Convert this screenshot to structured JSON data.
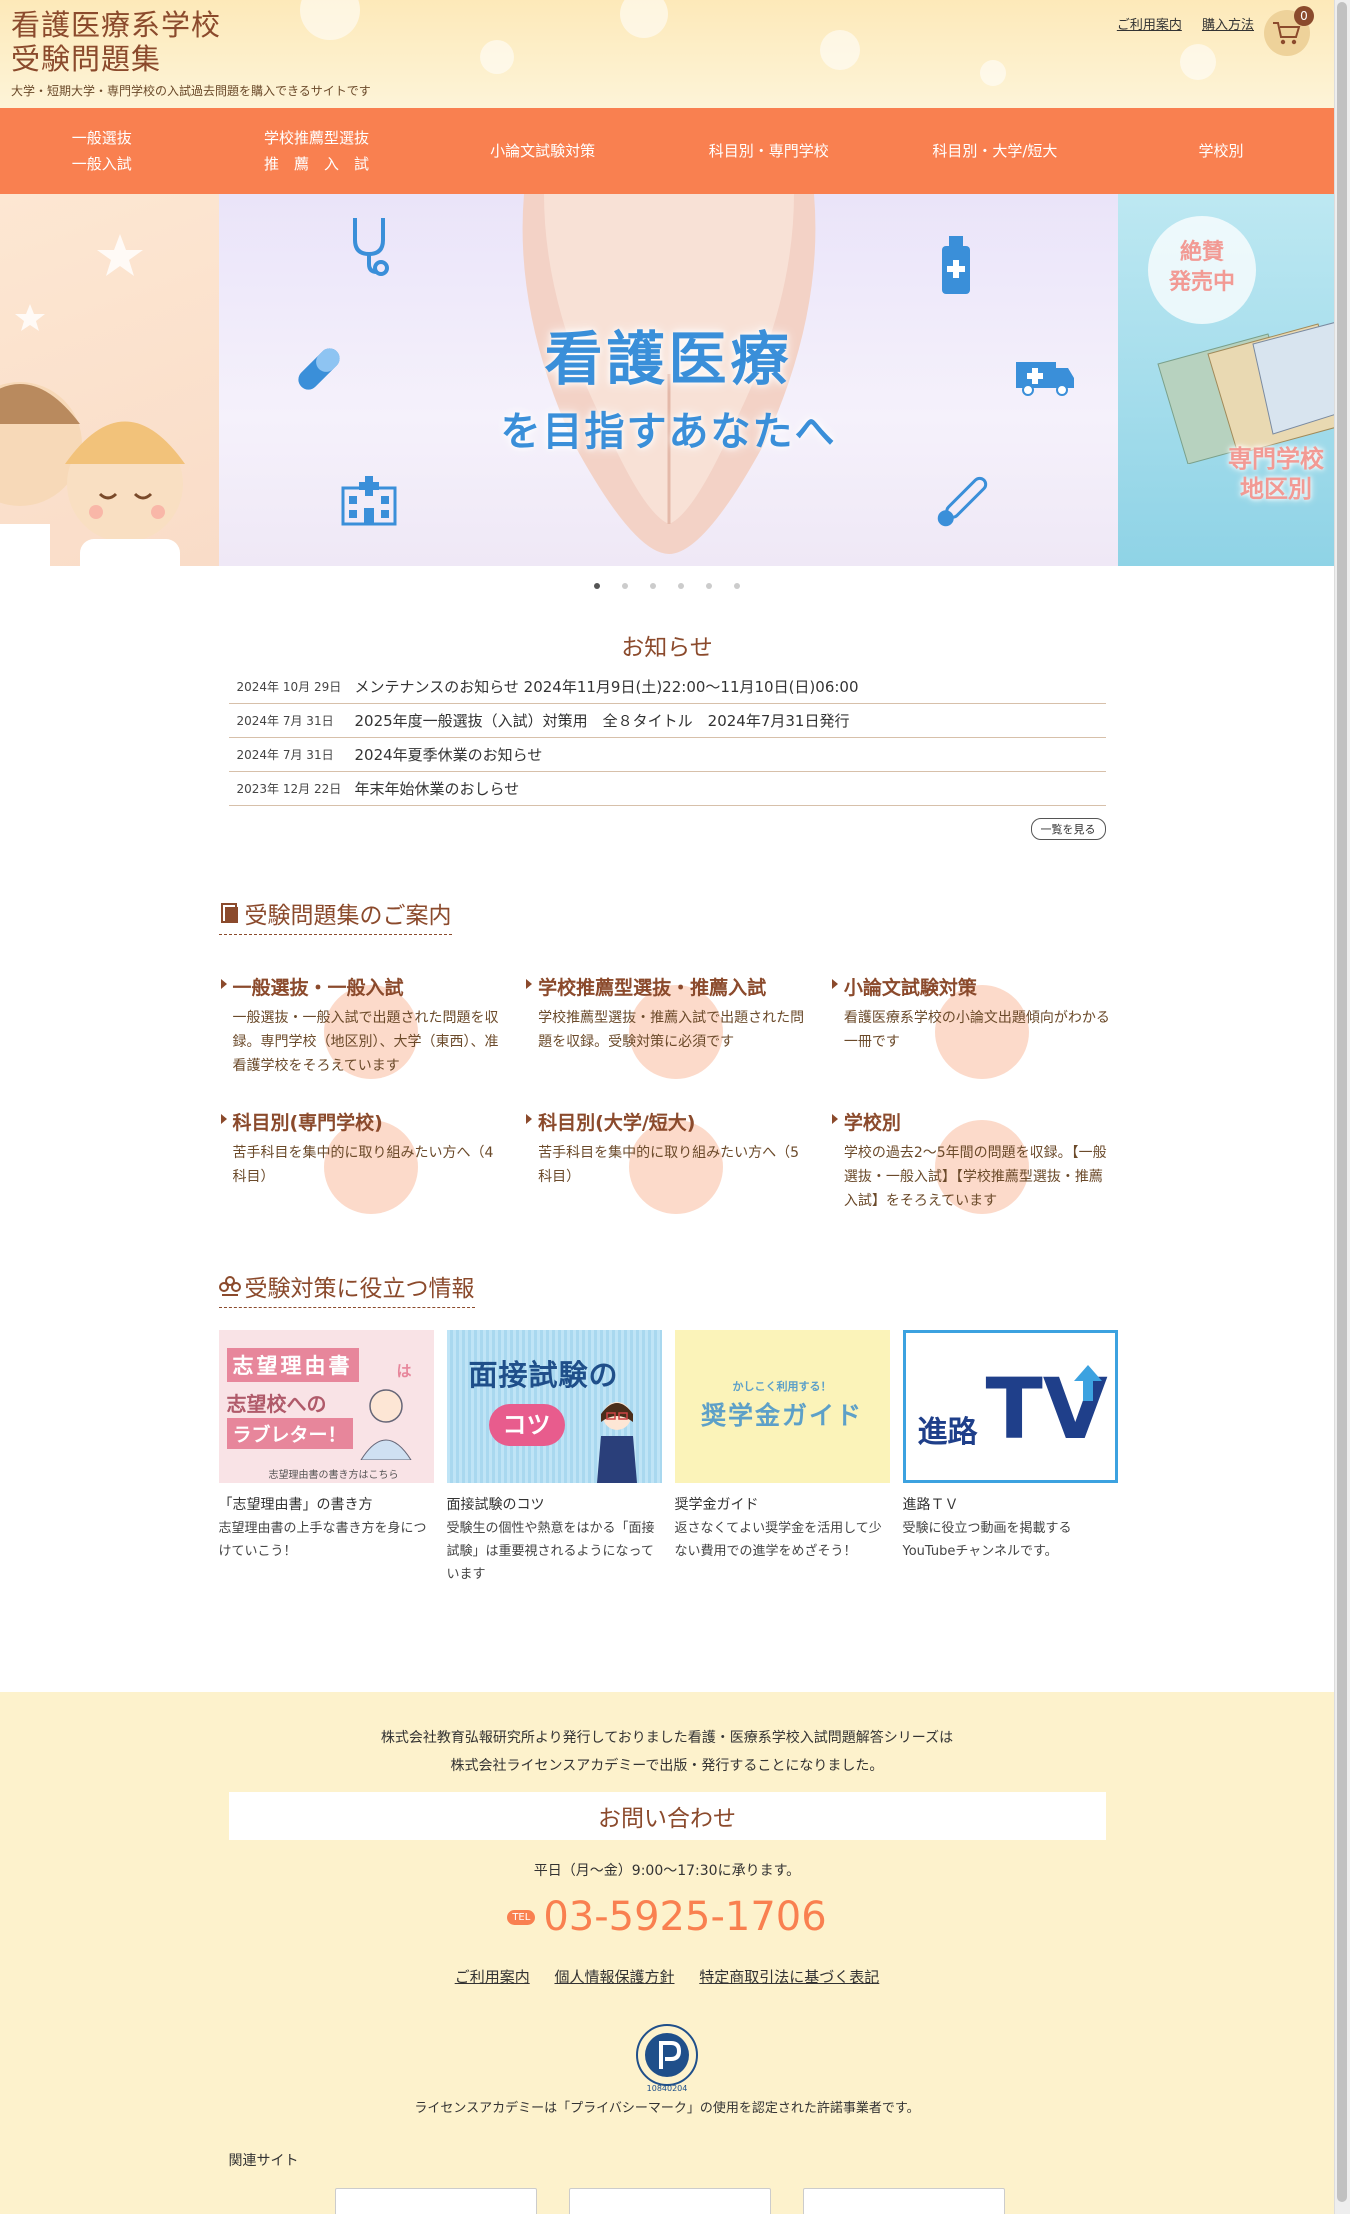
{
  "header": {
    "title_line1": "看護医療系学校",
    "title_line2": "受験問題集",
    "subtitle": "大学・短期大学・専門学校の入試過去問題を購入できるサイトです",
    "links": [
      "ご利用案内",
      "購入方法"
    ],
    "cart_count": "0"
  },
  "nav": {
    "items": [
      {
        "line1": "一般選抜",
        "line2": "一般入試"
      },
      {
        "line1": "学校推薦型選抜",
        "line2": "推　薦　入　試"
      },
      {
        "line1": "小論文試験対策",
        "line2": ""
      },
      {
        "line1": "科目別・専門学校",
        "line2": ""
      },
      {
        "line1": "科目別・大学/短大",
        "line2": ""
      },
      {
        "line1": "学校別",
        "line2": ""
      }
    ]
  },
  "hero": {
    "line1": "看護医療",
    "line2": "を目指すあなたへ",
    "sale_badge_l1": "絶賛",
    "sale_badge_l2": "発売中",
    "right_caption_l1": "専門学校",
    "right_caption_l2": "地区別",
    "slide_count": 6,
    "active_slide": 1
  },
  "news": {
    "title": "お知らせ",
    "items": [
      {
        "date": "2024年 10月 29日",
        "text": "メンテナンスのお知らせ 2024年11月9日(土)22:00～11月10日(日)06:00"
      },
      {
        "date": "2024年 7月 31日",
        "text": "2025年度一般選抜（入試）対策用　全８タイトル　2024年7月31日発行"
      },
      {
        "date": "2024年 7月 31日",
        "text": "2024年夏季休業のお知らせ"
      },
      {
        "date": "2023年 12月 22日",
        "text": "年末年始休業のおしらせ"
      }
    ],
    "more_label": "一覧を見る"
  },
  "guide": {
    "title": "受験問題集のご案内",
    "items": [
      {
        "title": "一般選抜・一般入試",
        "desc": "一般選抜・一般入試で出題された問題を収録。専門学校（地区別）、大学（東西）、准看護学校をそろえています"
      },
      {
        "title": "学校推薦型選抜・推薦入試",
        "desc": "学校推薦型選抜・推薦入試で出題された問題を収録。受験対策に必須です"
      },
      {
        "title": "小論文試験対策",
        "desc": "看護医療系学校の小論文出題傾向がわかる一冊です"
      },
      {
        "title": "科目別(専門学校)",
        "desc": "苦手科目を集中的に取り組みたい方へ（4科目）"
      },
      {
        "title": "科目別(大学/短大)",
        "desc": "苦手科目を集中的に取り組みたい方へ（5科目）"
      },
      {
        "title": "学校別",
        "desc": "学校の過去2～5年間の問題を収録。【一般選抜・一般入試】【学校推薦型選抜・推薦入試】をそろえています"
      }
    ]
  },
  "info": {
    "title": "受験対策に役立つ情報",
    "cards": [
      {
        "thumb_l1": "志望理由書",
        "thumb_l2": "は",
        "thumb_l3": "志望校への",
        "thumb_l4": "ラブレター！",
        "thumb_l5": "志望理由書の書き方はこちら",
        "title": "「志望理由書」の書き方",
        "desc": "志望理由書の上手な書き方を身につけていこう！"
      },
      {
        "thumb_l1": "面接試験の",
        "thumb_l2": "コツ",
        "thumb_l3": "",
        "thumb_l4": "",
        "thumb_l5": "",
        "title": "面接試験のコツ",
        "desc": "受験生の個性や熱意をはかる「面接試験」は重要視されるようになっています"
      },
      {
        "thumb_l1": "かしこく利用する！",
        "thumb_l2": "奨学金ガイド",
        "thumb_l3": "",
        "thumb_l4": "",
        "thumb_l5": "",
        "title": "奨学金ガイド",
        "desc": "返さなくてよい奨学金を活用して少ない費用での進学をめざそう！"
      },
      {
        "thumb_l1": "進路",
        "thumb_l2": "TV",
        "thumb_l3": "",
        "thumb_l4": "",
        "thumb_l5": "",
        "title": "進路ＴＶ",
        "desc": "受験に役立つ動画を掲載するYouTubeチャンネルです。"
      }
    ]
  },
  "footer": {
    "note_l1": "株式会社教育弘報研究所より発行しておりました看護・医療系学校入試問題解答シリーズは",
    "note_l2": "株式会社ライセンスアカデミーで出版・発行することになりました。",
    "contact_title": "お問い合わせ",
    "hours": "平日（月～金）9:00～17:30に承ります。",
    "tel_label": "TEL",
    "tel": "03-5925-1706",
    "links": [
      "ご利用案内",
      "個人情報保護方針",
      "特定商取引法に基づく表記"
    ],
    "pmark_number": "10840204",
    "pmark_note": "ライセンスアカデミーは「プライバシーマーク」の使用を認定された許諾事業者です。",
    "related_title": "関連サイト"
  },
  "colors": {
    "accent": "#f98050",
    "brown": "#8b4a2c",
    "header_bg": "#fde9b9",
    "footer_bg": "#fdf2cc"
  }
}
